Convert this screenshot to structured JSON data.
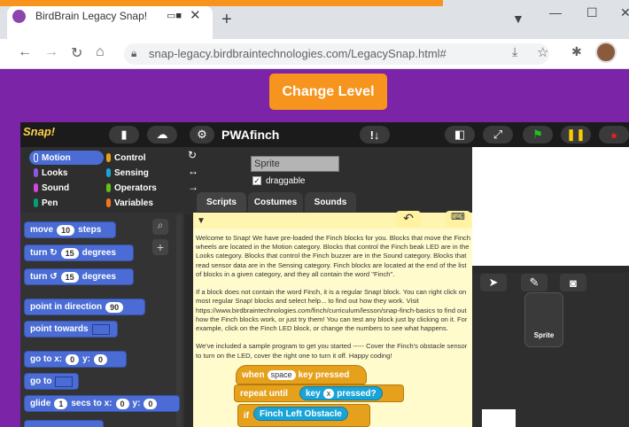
{
  "browser": {
    "tab_title": "BirdBrain Legacy Snap!",
    "new_tab_icon": "+",
    "close_icon": "✕",
    "url": "snap-legacy.birdbraintechnologies.com/LegacySnap.html#"
  },
  "page": {
    "change_level_label": "Change Level"
  },
  "snap": {
    "logo_text": "Snap!",
    "project_name": "PWAfinch",
    "categories": {
      "motion": "Motion",
      "looks": "Looks",
      "sound": "Sound",
      "pen": "Pen",
      "control": "Control",
      "sensing": "Sensing",
      "operators": "Operators",
      "variables": "Variables"
    },
    "blocks": {
      "move_pre": "move",
      "move_val": "10",
      "move_post": "steps",
      "turn_cw_pre": "turn",
      "turn_cw_val": "15",
      "turn_cw_post": "degrees",
      "turn_ccw_pre": "turn",
      "turn_ccw_val": "15",
      "turn_ccw_post": "degrees",
      "point_dir_pre": "point in direction",
      "point_dir_val": "90",
      "point_towards": "point towards",
      "goto_pre": "go to x:",
      "goto_x": "0",
      "goto_y_lbl": "y:",
      "goto_y": "0",
      "goto": "go to",
      "glide_pre": "glide",
      "glide_secs": "1",
      "glide_mid": "secs to x:",
      "glide_x": "0",
      "glide_y_lbl": "y:",
      "glide_y": "0"
    },
    "sprite": {
      "name": "Sprite",
      "draggable_label": "draggable"
    },
    "editor_tabs": {
      "scripts": "Scripts",
      "costumes": "Costumes",
      "sounds": "Sounds"
    },
    "comment_text": "Welcome to Snap! We have pre-loaded the Finch blocks for you. Blocks that move the Finch wheels are located in the Motion category. Blocks that control the Finch beak LED are in the Looks category. Blocks that control the Finch buzzer are in the Sound category. Blocks that read sensor data are in the Sensing category. Finch blocks are located at the end of the list of blocks in a given category, and they all contain the word \"Finch\".\n\nIf a block does not contain the word Finch, it is a regular Snap! block. You can right click on most regular Snap! blocks and select help... to find out how they work. Visit https://www.birdbraintechnologies.com/finch/curriculum/lesson/snap-finch-basics to find out how the Finch blocks work, or just try them! You can test any block just by clicking on it. For example, click on the Finch LED block, or change the numbers to see what happens.\n\nWe've included a sample program to get you started ----- Cover the Finch's obstacle sensor to turn on the LED, cover the right one to turn it off. Happy coding!",
    "script": {
      "when": "when",
      "when_key": "space",
      "when_post": "key pressed",
      "repeat_until": "repeat until",
      "key_pre": "key",
      "key_val": "x",
      "key_post": "pressed?",
      "if": "if",
      "finch_sensor": "Finch Left Obstacle"
    },
    "sprite_corral_label": "Sprite"
  }
}
